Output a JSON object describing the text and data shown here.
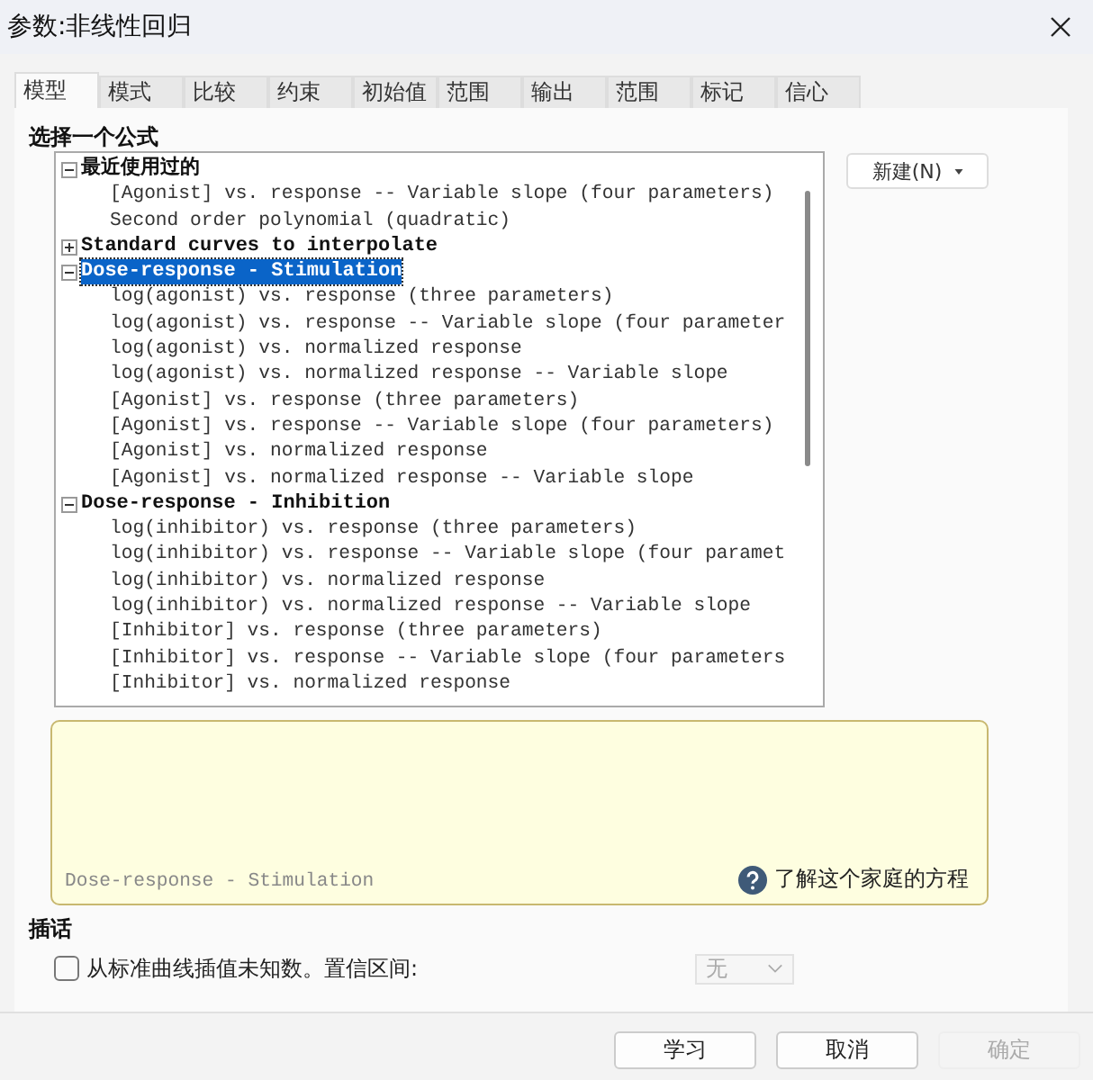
{
  "window": {
    "title": "参数:非线性回归"
  },
  "tabs": [
    {
      "label": "模型",
      "selected": true
    },
    {
      "label": "模式",
      "selected": false
    },
    {
      "label": "比较",
      "selected": false
    },
    {
      "label": "约束",
      "selected": false
    },
    {
      "label": "初始值",
      "selected": false
    },
    {
      "label": "范围",
      "selected": false
    },
    {
      "label": "输出",
      "selected": false
    },
    {
      "label": "范围",
      "selected": false
    },
    {
      "label": "标记",
      "selected": false
    },
    {
      "label": "信心",
      "selected": false
    }
  ],
  "section_title": "选择一个公式",
  "tree": [
    {
      "label": "最近使用过的",
      "expanded": true,
      "selected": false,
      "children": [
        {
          "label": "[Agonist] vs. response -- Variable slope (four parameters)",
          "selected": false
        },
        {
          "label": "Second order polynomial (quadratic)",
          "selected": false
        }
      ]
    },
    {
      "label": "Standard curves to interpolate",
      "expanded": false,
      "selected": false
    },
    {
      "label": "Dose-response - Stimulation",
      "expanded": true,
      "selected": true,
      "children": [
        {
          "label": "log(agonist) vs. response (three parameters)",
          "selected": false
        },
        {
          "label": "log(agonist) vs. response -- Variable slope (four parameter",
          "selected": false
        },
        {
          "label": "log(agonist) vs. normalized response",
          "selected": false
        },
        {
          "label": "log(agonist) vs. normalized response -- Variable slope",
          "selected": false
        },
        {
          "label": "[Agonist] vs. response (three parameters)",
          "selected": false
        },
        {
          "label": "[Agonist] vs. response -- Variable slope (four parameters)",
          "selected": false
        },
        {
          "label": "[Agonist] vs. normalized response",
          "selected": false
        },
        {
          "label": "[Agonist] vs. normalized response -- Variable slope",
          "selected": false
        }
      ]
    },
    {
      "label": "Dose-response - Inhibition",
      "expanded": true,
      "selected": false,
      "children": [
        {
          "label": "log(inhibitor) vs. response (three parameters)",
          "selected": false
        },
        {
          "label": "log(inhibitor) vs. response -- Variable slope (four paramet",
          "selected": false
        },
        {
          "label": "log(inhibitor) vs. normalized response",
          "selected": false
        },
        {
          "label": "log(inhibitor) vs. normalized response -- Variable slope",
          "selected": false
        },
        {
          "label": "[Inhibitor] vs. response (three parameters)",
          "selected": false
        },
        {
          "label": "[Inhibitor] vs. response -- Variable slope (four parameters",
          "selected": false
        },
        {
          "label": "[Inhibitor] vs. normalized response",
          "selected": false
        }
      ]
    }
  ],
  "new_button": {
    "label": "新建(N)"
  },
  "description": {
    "family": "Dose-response - Stimulation",
    "help_link": "了解这个家庭的方程"
  },
  "interpolate": {
    "title": "插话",
    "checkbox": {
      "label": "从标准曲线插值未知数。置信区间:",
      "checked": false
    },
    "dropdown": {
      "value": "无",
      "disabled": true
    }
  },
  "buttons": [
    {
      "label": "学习",
      "disabled": false
    },
    {
      "label": "取消",
      "disabled": false
    },
    {
      "label": "确定",
      "disabled": true
    }
  ]
}
